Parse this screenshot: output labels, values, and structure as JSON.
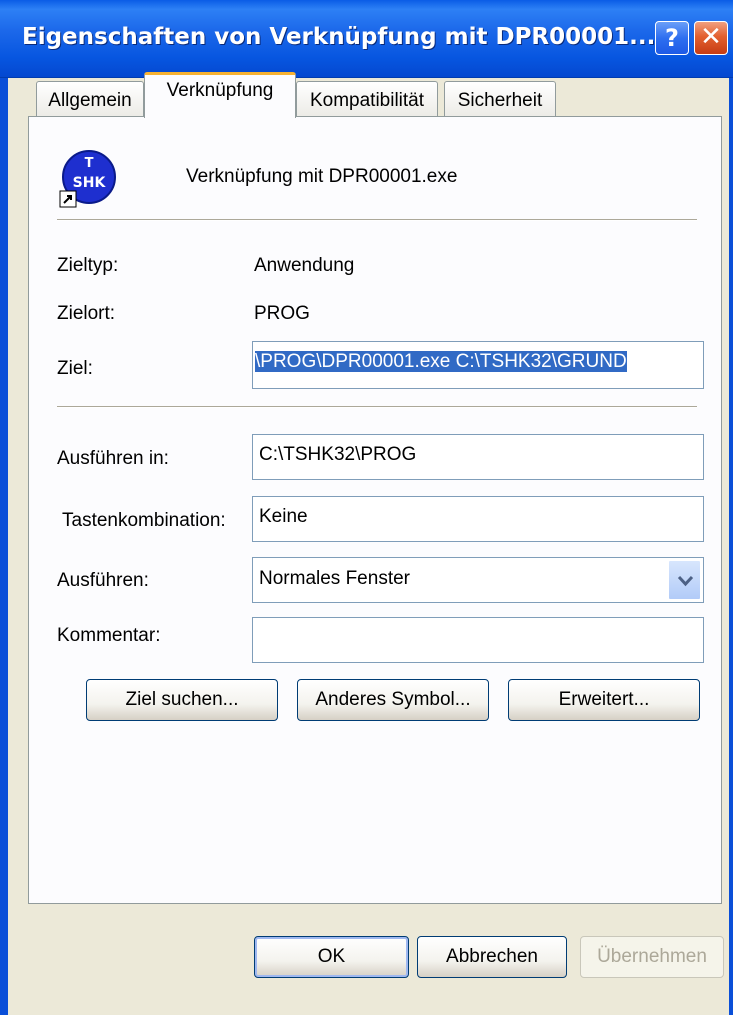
{
  "window": {
    "title": "Eigenschaften von Verknüpfung mit DPR00001....",
    "help_label": "?",
    "close_label": "✕"
  },
  "tabs": [
    {
      "label": "Allgemein",
      "active": false
    },
    {
      "label": "Verknüpfung",
      "active": true
    },
    {
      "label": "Kompatibilität",
      "active": false
    },
    {
      "label": "Sicherheit",
      "active": false
    }
  ],
  "shortcut": {
    "icon": "shortcut-app-icon",
    "name": "Verknüpfung mit DPR00001.exe"
  },
  "fields": {
    "zieltyp_label": "Zieltyp:",
    "zieltyp_value": "Anwendung",
    "zielort_label": "Zielort:",
    "zielort_value": "PROG",
    "ziel_label": "Ziel:",
    "ziel_value": "\\PROG\\DPR00001.exe C:\\TSHK32\\GRUND",
    "ausfuehren_in_label": "Ausführen in:",
    "ausfuehren_in_value": "C:\\TSHK32\\PROG",
    "tasten_label": "Tastenkombination:",
    "tasten_value": "Keine",
    "ausfuehren_label": "Ausführen:",
    "ausfuehren_value": "Normales Fenster",
    "kommentar_label": "Kommentar:",
    "kommentar_value": ""
  },
  "actions": {
    "ziel_suchen": "Ziel suchen...",
    "anderes_symbol": "Anderes Symbol...",
    "erweitert": "Erweitert..."
  },
  "footer": {
    "ok": "OK",
    "abbrechen": "Abbrechen",
    "uebernehmen": "Übernehmen"
  },
  "colors": {
    "titlebar": "#0a5ce6",
    "selection": "#316ac5",
    "close_button": "#e3602f"
  }
}
